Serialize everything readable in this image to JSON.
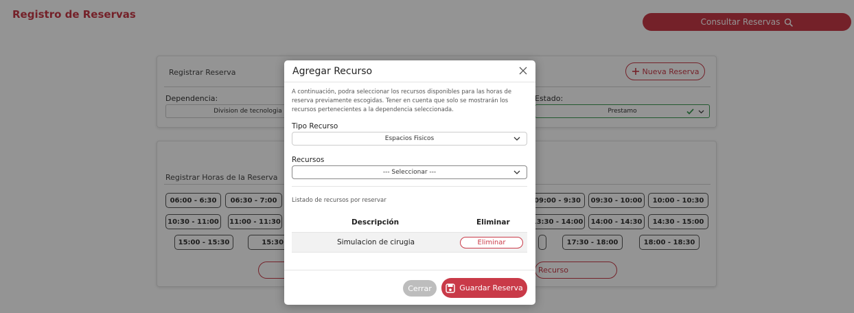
{
  "header": {
    "title": "Registro de Reservas",
    "consult_label": "Consultar Reservas"
  },
  "card_registro": {
    "title": "Registrar Reserva",
    "new_label": "Nueva Reserva",
    "dependencia_label": "Dependencia:",
    "dependencia_value": "Division de tecnologia",
    "estado_label": "Estado:",
    "estado_value": "Prestamo"
  },
  "card_horas": {
    "title": "Registrar Horas de la Reserva",
    "slots": [
      "06:00 - 6:30",
      "06:30 - 7:00",
      "09:00 - 9:30",
      "09:30 - 10:00",
      "10:00 - 10:30",
      "10:30 - 11:00",
      "11:00 - 11:30",
      "13:30 - 14:00",
      "14:00 - 14:30",
      "14:30 - 15:00",
      "15:00 - 15:30",
      "15:30 -",
      "17:30 - 18:00",
      "18:00 - 18:30"
    ],
    "add_resource_label": "Recurso"
  },
  "modal": {
    "title": "Agregar Recurso",
    "description": "A continuación, podra seleccionar los recursos disponibles para las horas de reserva previamente escogidas. Tener en cuenta que solo se mostrarán los recursos pertenecientes a la dependencia seleccionada.",
    "tipo_label": "Tipo Recurso",
    "tipo_value": "Espacios Fisicos",
    "recursos_label": "Recursos",
    "recursos_value": "--- Seleccionar ---",
    "list_title": "Listado de recursos por reservar",
    "col_desc": "Descripción",
    "col_del": "Eliminar",
    "rows": [
      {
        "descripcion": "Simulacion de cirugia",
        "eliminar": "Eliminar"
      }
    ],
    "close_label": "Cerrar",
    "save_label": "Guardar Reserva"
  },
  "colors": {
    "accent": "#c93a48",
    "success": "#3b9a52"
  }
}
